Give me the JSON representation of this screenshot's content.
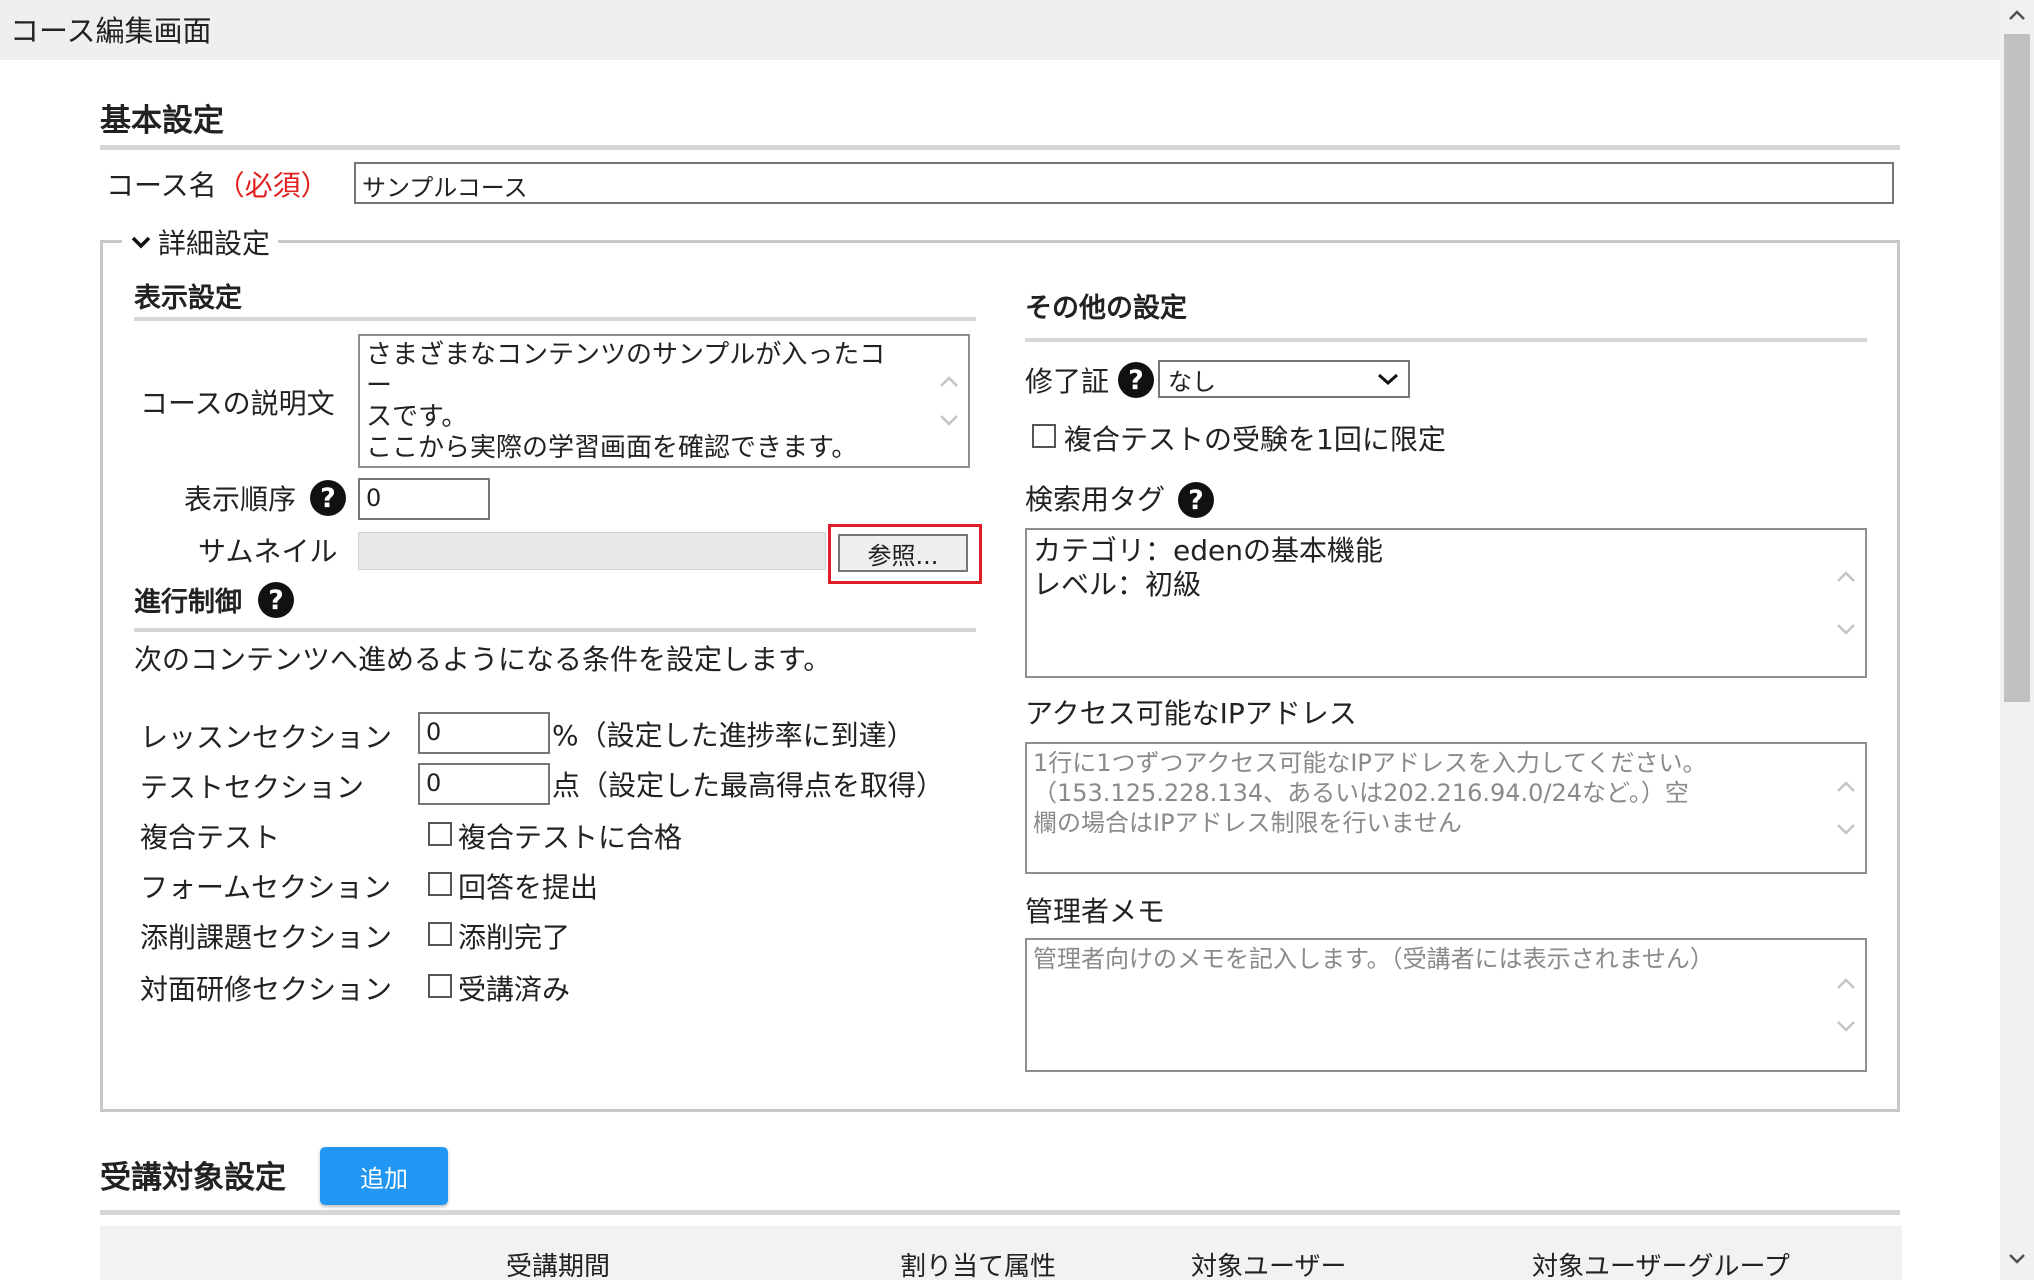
{
  "window": {
    "title": "コース編集画面"
  },
  "basic": {
    "heading": "基本設定",
    "course_name_label": "コース名",
    "required_mark": "（必須）",
    "course_name_value": "サンプルコース"
  },
  "details": {
    "legend": "詳細設定"
  },
  "display": {
    "heading": "表示設定",
    "description_label": "コースの説明文",
    "description_lines": [
      "さまざまなコンテンツのサンプルが入ったコー",
      "スです。",
      "ここから実際の学習画面を確認できます。"
    ],
    "order_label": "表示順序",
    "order_value": "0",
    "thumbnail_label": "サムネイル",
    "browse_label": "参照..."
  },
  "progress": {
    "heading": "進行制御",
    "description": "次のコンテンツへ進めるようになる条件を設定します。",
    "lesson_label": "レッスンセクション",
    "lesson_value": "0",
    "lesson_suffix": "%（設定した進捗率に到達）",
    "test_label": "テストセクション",
    "test_value": "0",
    "test_suffix": "点（設定した最高得点を取得）",
    "composite_label": "複合テスト",
    "composite_check": "複合テストに合格",
    "form_label": "フォームセクション",
    "form_check": "回答を提出",
    "review_label": "添削課題セクション",
    "review_check": "添削完了",
    "inperson_label": "対面研修セクション",
    "inperson_check": "受講済み"
  },
  "other": {
    "heading": "その他の設定",
    "certificate_label": "修了証",
    "certificate_value": "なし",
    "limit_check": "複合テストの受験を1回に限定",
    "tags_label": "検索用タグ",
    "tags_lines": [
      "カテゴリ：edenの基本機能",
      "レベル：初級"
    ],
    "ip_label": "アクセス可能なIPアドレス",
    "ip_placeholder_lines": [
      "1行に1つずつアクセス可能なIPアドレスを入力してください。",
      "（153.125.228.134、あるいは202.216.94.0/24など。）空",
      "欄の場合はIPアドレス制限を行いません"
    ],
    "memo_label": "管理者メモ",
    "memo_placeholder": "管理者向けのメモを記入します。（受講者には表示されません）"
  },
  "target": {
    "heading": "受講対象設定",
    "add_label": "追加",
    "columns": [
      "受講期間",
      "割り当て属性",
      "対象ユーザー",
      "対象ユーザーグループ"
    ]
  },
  "colors": {
    "accent": "#2196f3",
    "required": "#e02020",
    "highlight": "#e01e2a"
  }
}
